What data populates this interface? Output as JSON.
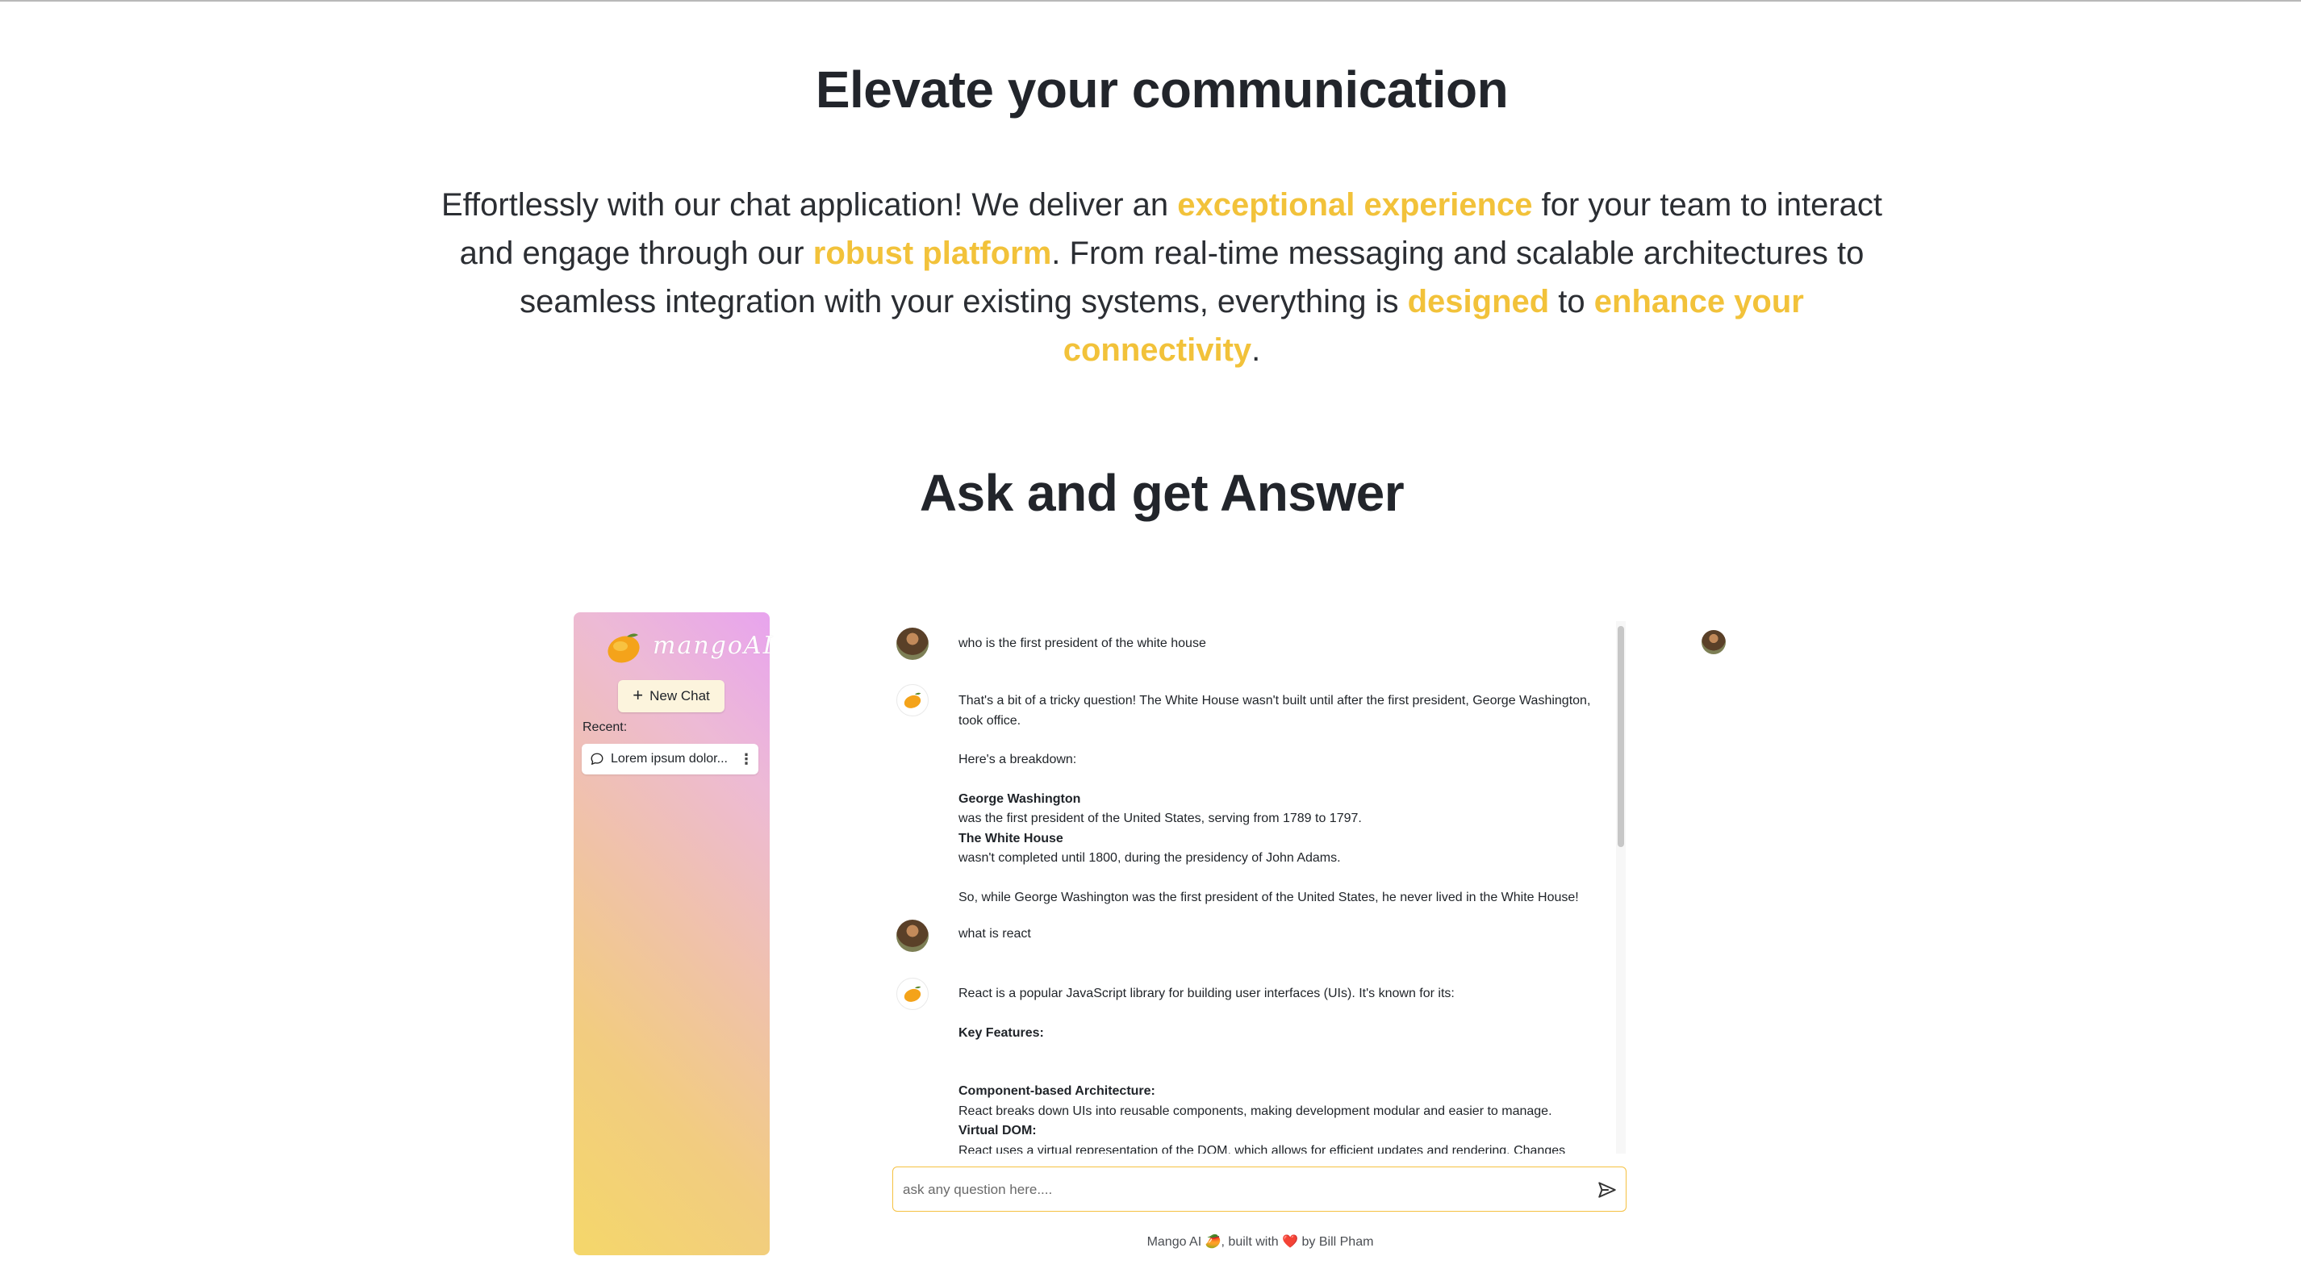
{
  "hero": {
    "title": "Elevate your communication",
    "intro": {
      "t1": "Effortlessly with our chat application! We deliver an ",
      "h1": "exceptional experience",
      "t2": " for your team to interact and engage through our ",
      "h2": "robust platform",
      "t3": ". From real-time messaging and scalable architectures to seamless integration with your existing systems, everything is ",
      "h3": "designed",
      "t4": " to ",
      "h4": "enhance your connectivity",
      "t5": "."
    },
    "highlight_color": "#f2c23a"
  },
  "section": {
    "title": "Ask and get Answer"
  },
  "app": {
    "brand": "mangoAI",
    "new_chat_label": "New Chat",
    "recent_label": "Recent:",
    "recent_items": [
      {
        "label": "Lorem ipsum dolor..."
      }
    ],
    "messages": [
      {
        "role": "user",
        "lines": [
          "who is the first president of the white house"
        ]
      },
      {
        "role": "bot",
        "blocks": [
          {
            "type": "p",
            "text": "That's a bit of a tricky question! The White House wasn't built until after the first president, George Washington, took office."
          },
          {
            "type": "gap"
          },
          {
            "type": "p",
            "text": "Here's a breakdown:"
          },
          {
            "type": "gap"
          },
          {
            "type": "b",
            "text": "George Washington"
          },
          {
            "type": "p",
            "text": "was the first president of the United States, serving from 1789 to 1797."
          },
          {
            "type": "b",
            "text": "The White House"
          },
          {
            "type": "p",
            "text": "wasn't completed until 1800, during the presidency of John Adams."
          },
          {
            "type": "gap"
          },
          {
            "type": "p",
            "text": "So, while George Washington was the first president of the United States, he never lived in the White House!"
          }
        ]
      },
      {
        "role": "user",
        "lines": [
          "what is react"
        ]
      },
      {
        "role": "bot",
        "blocks": [
          {
            "type": "p",
            "text": "React is a popular JavaScript library for building user interfaces (UIs). It's known for its:"
          },
          {
            "type": "gap"
          },
          {
            "type": "b",
            "text": "Key Features:"
          },
          {
            "type": "gap"
          },
          {
            "type": "gap"
          },
          {
            "type": "b",
            "text": "Component-based Architecture:"
          },
          {
            "type": "p",
            "text": "React breaks down UIs into reusable components, making development modular and easier to manage."
          },
          {
            "type": "b",
            "text": "Virtual DOM:"
          },
          {
            "type": "p",
            "text": "React uses a virtual representation of the DOM, which allows for efficient updates and rendering. Changes"
          }
        ]
      }
    ],
    "input_placeholder": "ask any question here....",
    "footer": {
      "t1": "Mango AI ",
      "mango": "🥭",
      "t2": ", built with ",
      "heart": "❤️",
      "t3": " by Bill Pham"
    }
  },
  "icons": {
    "new_chat": "plus-icon",
    "recent": "chat-bubble-icon",
    "menu": "kebab-menu-icon",
    "send": "send-icon"
  }
}
